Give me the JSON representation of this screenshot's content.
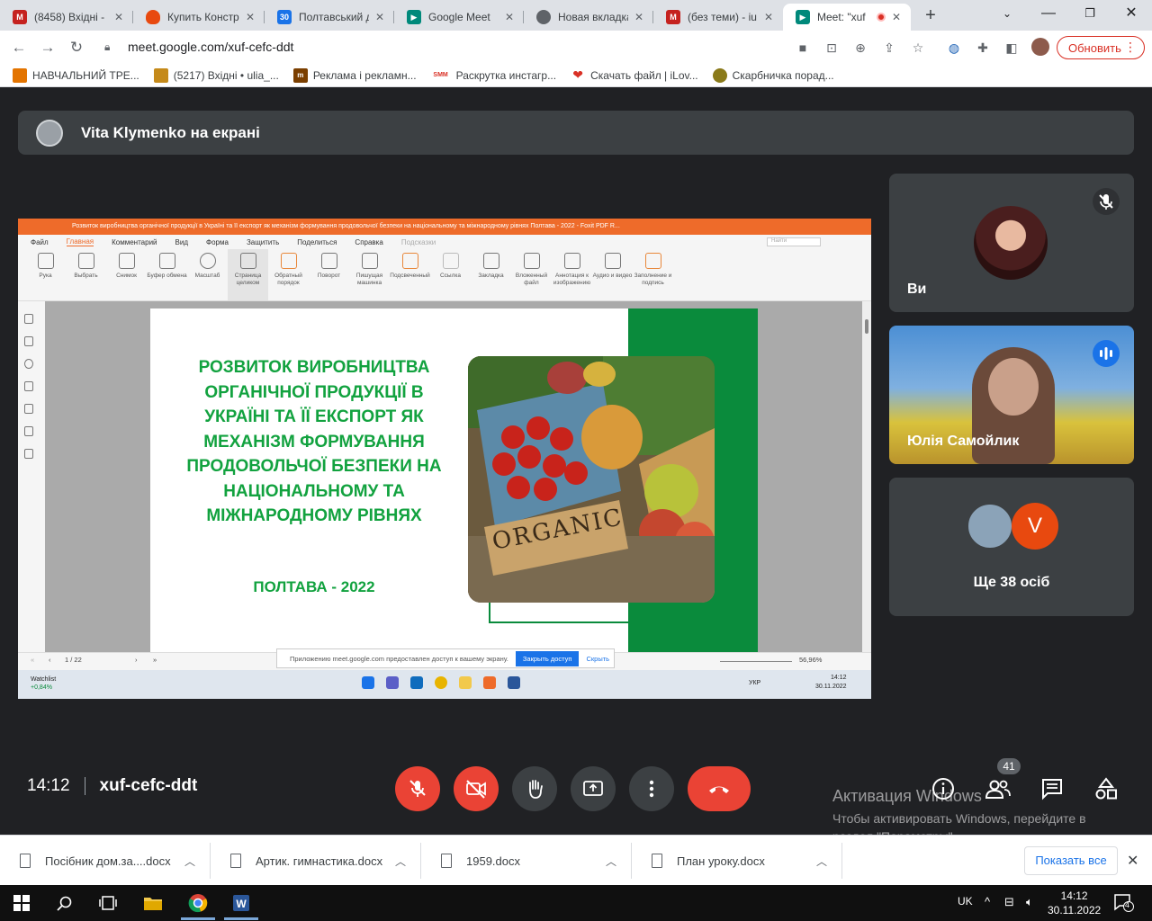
{
  "browser": {
    "tabs": [
      {
        "title": "(8458) Вхідні -",
        "favicon": "gmail-icon",
        "color": "#c5221f"
      },
      {
        "title": "Купить Констр",
        "favicon": "flame-icon",
        "color": "#e8490f"
      },
      {
        "title": "Полтавський д",
        "favicon": "calendar-icon",
        "color": "#1a73e8"
      },
      {
        "title": "Google Meet",
        "favicon": "meet-icon",
        "color": "#00897b"
      },
      {
        "title": "Новая вкладка",
        "favicon": "chrome-icon",
        "color": "#5f6368"
      },
      {
        "title": "(без теми) - iu",
        "favicon": "gmail-icon",
        "color": "#c5221f"
      },
      {
        "title": "Meet: \"xuf",
        "favicon": "meet-icon",
        "color": "#00897b",
        "active": true
      }
    ],
    "url": "meet.google.com/xuf-cefc-ddt",
    "update_label": "Обновить",
    "bookmarks": [
      {
        "label": "НАВЧАЛЬНИЙ ТРЕ...",
        "icon": "colorful-folder-icon",
        "color": "#e37400"
      },
      {
        "label": "(5217) Вхідні • ulia_...",
        "icon": "folder-icon",
        "color": "#c58a1a"
      },
      {
        "label": "Реклама і рекламн...",
        "icon": "m-logo-icon",
        "color": "#7b3f00"
      },
      {
        "label": "Раскрутка инстагр...",
        "icon": "smm-icon",
        "color": "#d93025",
        "text": "SMM"
      },
      {
        "label": "Скачать файл | iLov...",
        "icon": "heart-icon",
        "color": "#d93025"
      },
      {
        "label": "Скарбничка порад...",
        "icon": "seal-icon",
        "color": "#8a7a1a"
      }
    ]
  },
  "meet": {
    "presenter": "Vita Klymenko на екрані",
    "time": "14:12",
    "code": "xuf-cefc-ddt",
    "participant_count": "41",
    "tiles": {
      "you": "Ви",
      "yulia": "Юлія Самойлик",
      "others": "Ще 38 осіб",
      "others_initial": "V"
    },
    "colors": {
      "accent": "#1a73e8",
      "danger": "#ea4335",
      "surface": "#3c4043",
      "background": "#202124"
    }
  },
  "shared_screen": {
    "app_title": "Розвиток виробництва органічної продукції в Україні та її експорт як механізм формування продовольчої безпеки на національному та міжнародному рівнях Полтава - 2022 - Foxit PDF R...",
    "menu": [
      "Файл",
      "Главная",
      "Комментарий",
      "Вид",
      "Форма",
      "Защитить",
      "Поделиться",
      "Справка",
      "Подсказки"
    ],
    "ribbon_tools": [
      "Рука",
      "Выбрать",
      "Снимок",
      "Буфер обмена",
      "Масштаб",
      "Страница целиком",
      "Обратный порядок",
      "Поворот",
      "Пишущая машинка",
      "Подсвеченный",
      "Ссылка",
      "Закладка",
      "Вложенный файл",
      "Аннотация к изображению",
      "Аудио и видео",
      "Заполнение и подпись"
    ],
    "search_placeholder": "Найти",
    "slide_title": "РОЗВИТОК ВИРОБНИЦТВА ОРГАНІЧНОЇ ПРОДУКЦІЇ В УКРАЇНІ ТА ЇЇ ЕКСПОРТ ЯК МЕХАНІЗМ ФОРМУВАННЯ ПРОДОВОЛЬЧОЇ БЕЗПЕКИ НА НАЦІОНАЛЬНОМУ ТА МІЖНАРОДНОМУ РІВНЯХ",
    "slide_subtitle": "ПОЛТАВА - 2022",
    "photo_label": "ORGANIC",
    "page_indicator": "1 / 22",
    "zoom": "56,96%",
    "share_notice": "Приложению meet.google.com предоставлен доступ к вашему экрану.",
    "share_stop": "Закрыть доступ",
    "share_hide": "Скрыть",
    "taskbar_watchlist": "Watchlist",
    "taskbar_watch_pct": "+0,84%",
    "taskbar_lang": "УКР",
    "taskbar_time": "14:12",
    "taskbar_date": "30.11.2022"
  },
  "activation": {
    "title": "Активация Windows",
    "text": "Чтобы активировать Windows, перейдите в раздел \"Параметры\"."
  },
  "downloads": {
    "files": [
      "Посібник дом.за....docx",
      "Артик. гимнастика.docx",
      "1959.docx",
      "План уроку.docx"
    ],
    "show_all": "Показать все"
  },
  "taskbar": {
    "lang": "UK",
    "time": "14:12",
    "date": "30.11.2022",
    "notifications": "4"
  }
}
